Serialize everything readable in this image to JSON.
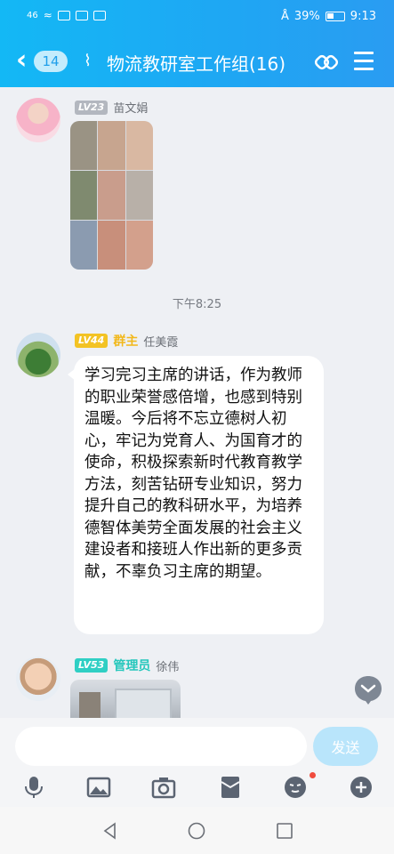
{
  "status_bar": {
    "signal": "46",
    "battery_percent": "39%",
    "time": "9:13"
  },
  "header": {
    "back_count": "14",
    "title": "物流教研室工作组(16)"
  },
  "messages": [
    {
      "level": "LV23",
      "role": "",
      "name": "苗文娟"
    },
    {
      "level": "LV44",
      "role": "群主",
      "name": "任美霞",
      "text": "学习完习主席的讲话，作为教师的职业荣誉感倍增，也感到特别温暖。今后将不忘立德树人初心，牢记为党育人、为国育才的使命，积极探索新时代教育教学方法，刻苦钻研专业知识，努力提升自己的教科研水平，为培养德智体美劳全面发展的社会主义建设者和接班人作出新的更多贡献，不辜负习主席的期望。"
    },
    {
      "level": "LV53",
      "role": "管理员",
      "name": "徐伟"
    }
  ],
  "timestamp": "下午8:25",
  "input_bar": {
    "placeholder": "",
    "send_label": "发送"
  },
  "colors": {
    "header": "#1fa6f3",
    "send_button": "#b9e5fb",
    "owner_tag": "#f3c324",
    "admin_tag": "#2fcfc4"
  },
  "icons": [
    "mic-icon",
    "image-icon",
    "camera-icon",
    "red-packet-icon",
    "emoji-icon",
    "plus-icon"
  ]
}
